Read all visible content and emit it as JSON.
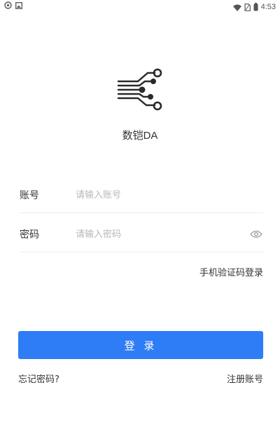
{
  "status_bar": {
    "time": "4:53",
    "left_icons": [
      "notification-icon",
      "image-notification-icon"
    ],
    "right_icons": [
      "wifi-icon",
      "sim-card-icon",
      "battery-icon"
    ]
  },
  "app": {
    "name": "数铠DA",
    "logo_icon": "circuit-logo-icon"
  },
  "form": {
    "account": {
      "label": "账号",
      "placeholder": "请输入账号",
      "value": ""
    },
    "password": {
      "label": "密码",
      "placeholder": "请输入密码",
      "value": "",
      "toggle_icon": "eye-icon"
    },
    "sms_login_link": "手机验证码登录",
    "login_button": "登 录",
    "forgot_link": "忘记密码?",
    "register_link": "注册账号"
  },
  "colors": {
    "primary": "#2f7df6",
    "text": "#333333",
    "placeholder": "#b8b8b8",
    "divider": "#eeeeee"
  }
}
